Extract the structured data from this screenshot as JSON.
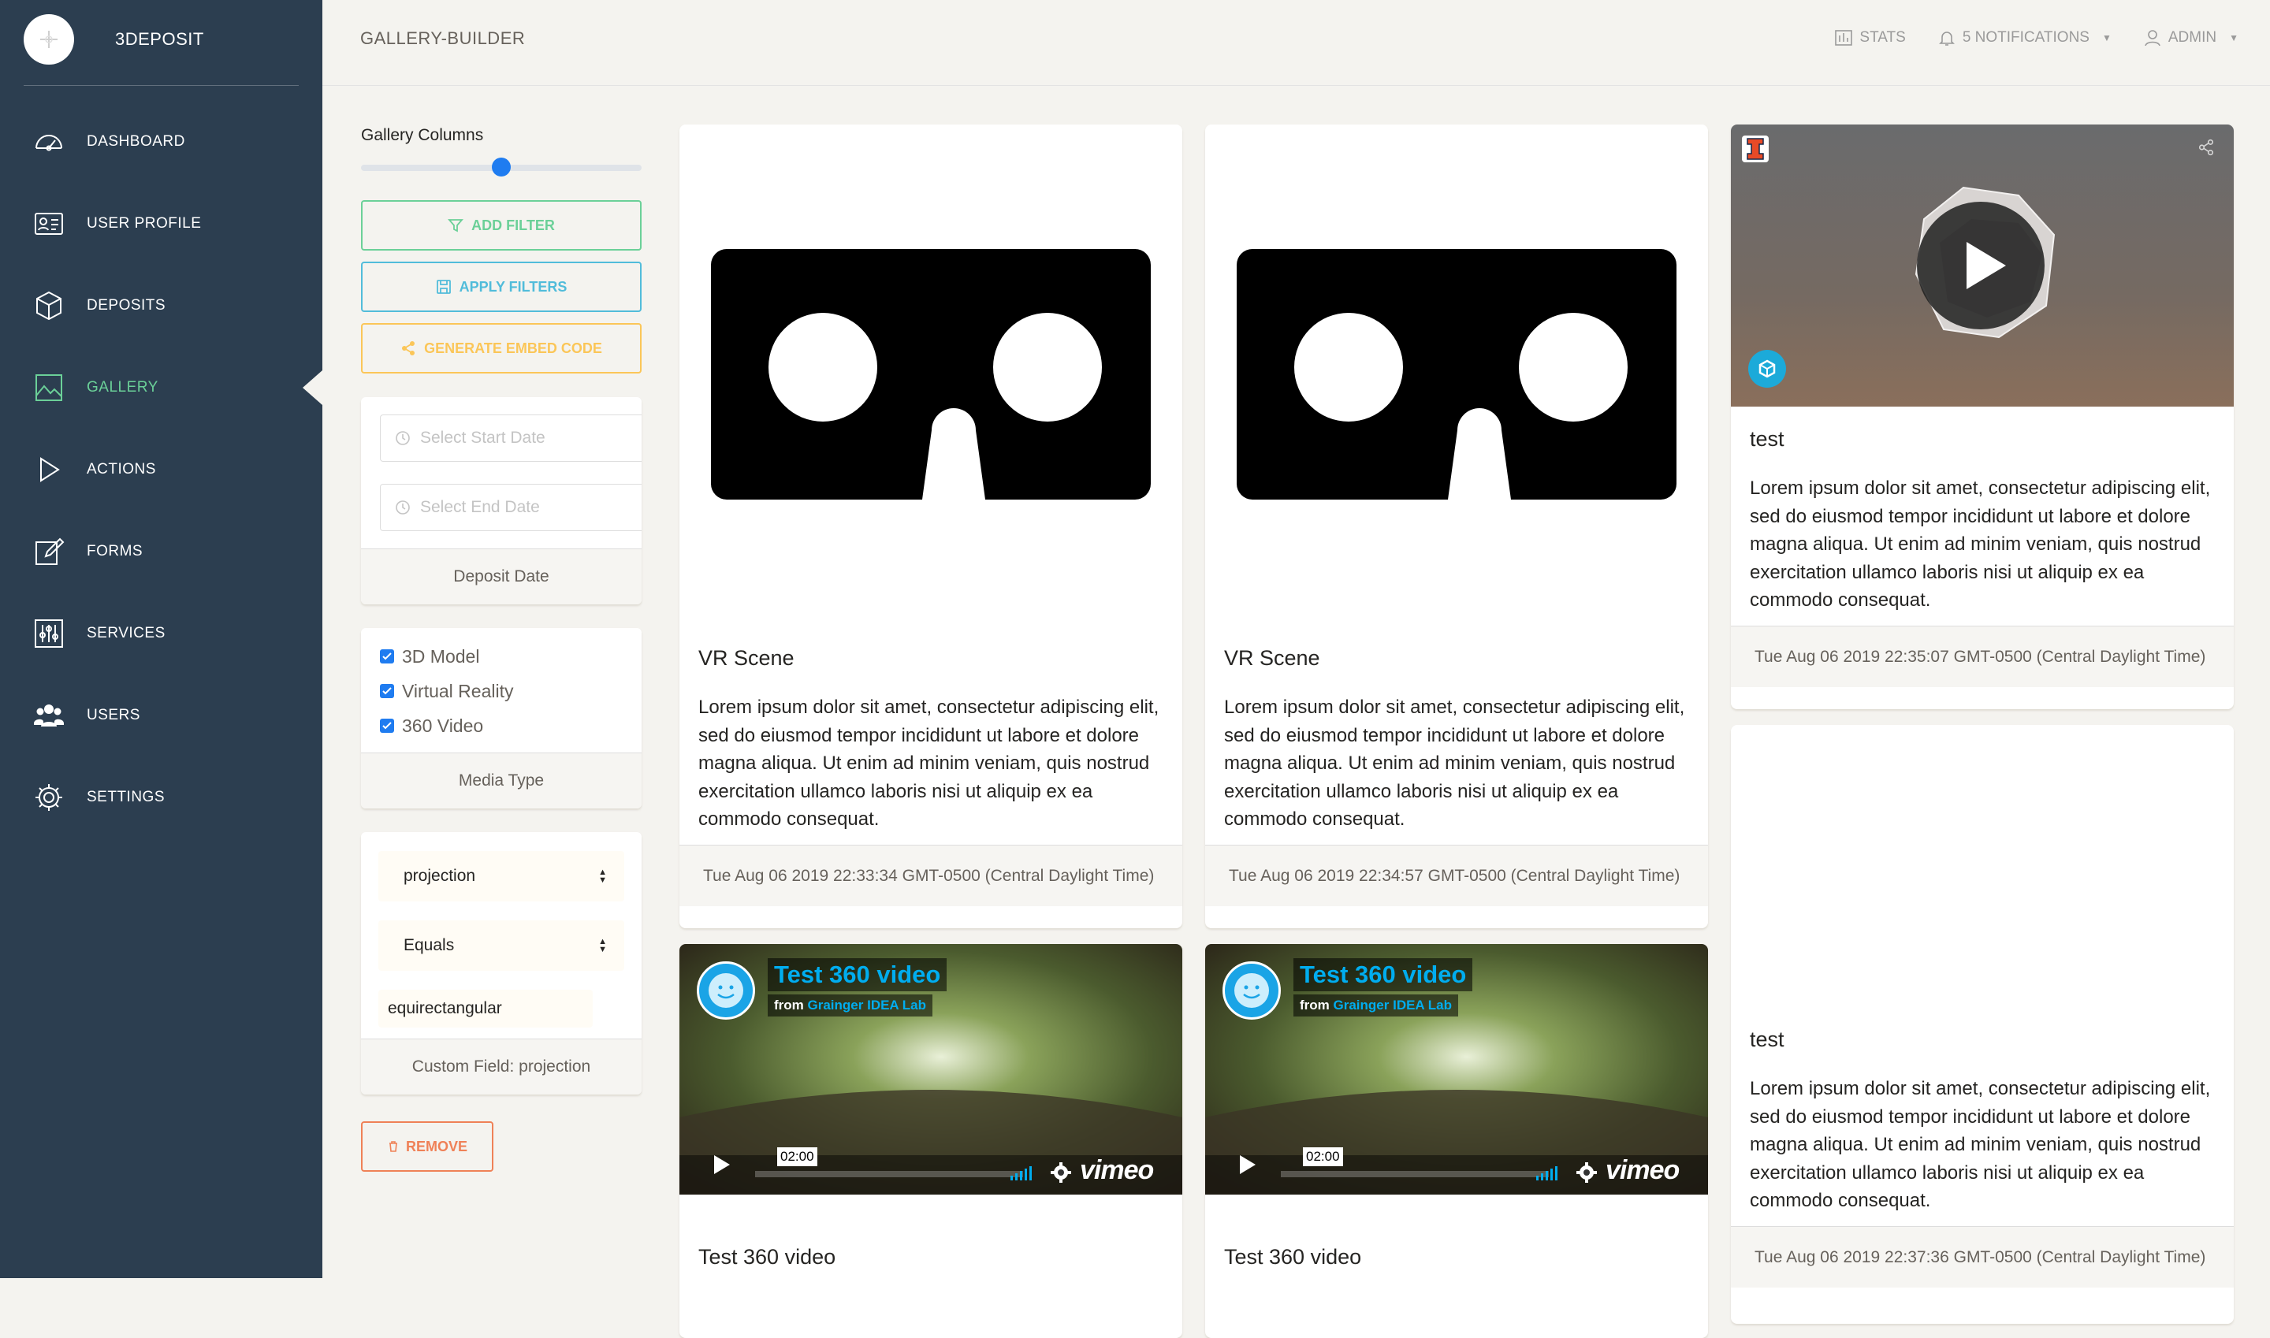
{
  "brand": {
    "name": "3DEPOSIT"
  },
  "nav": [
    {
      "label": "DASHBOARD",
      "icon": "dashboard-icon"
    },
    {
      "label": "USER PROFILE",
      "icon": "user-profile-icon"
    },
    {
      "label": "DEPOSITS",
      "icon": "box-icon"
    },
    {
      "label": "GALLERY",
      "icon": "gallery-icon",
      "active": true
    },
    {
      "label": "ACTIONS",
      "icon": "play-icon"
    },
    {
      "label": "FORMS",
      "icon": "edit-icon"
    },
    {
      "label": "SERVICES",
      "icon": "sliders-icon"
    },
    {
      "label": "USERS",
      "icon": "users-icon"
    },
    {
      "label": "SETTINGS",
      "icon": "gear-icon"
    }
  ],
  "topbar": {
    "title": "GALLERY-BUILDER",
    "stats": "STATS",
    "notifications": "5 NOTIFICATIONS",
    "user": "ADMIN"
  },
  "filters": {
    "columns_label": "Gallery Columns",
    "columns_slider_fraction": 0.5,
    "add_filter": "ADD FILTER",
    "apply_filters": "APPLY FILTERS",
    "embed_code": "GENERATE EMBED CODE",
    "start_date_placeholder": "Select Start Date",
    "end_date_placeholder": "Select End Date",
    "deposit_date_label": "Deposit Date",
    "media_types": [
      "3D Model",
      "Virtual Reality",
      "360 Video"
    ],
    "media_type_label": "Media Type",
    "custom_field_select": "projection",
    "operator_select": "Equals",
    "custom_value": "equirectangular",
    "custom_field_label": "Custom Field: projection",
    "remove": "REMOVE"
  },
  "lorem": "Lorem ipsum dolor sit amet, consectetur adipiscing elit, sed do eiusmod tempor incididunt ut labore et dolore magna aliqua. Ut enim ad minim veniam, quis nostrud exercitation ullamco laboris nisi ut aliquip ex ea commodo consequat.",
  "cards": [
    {
      "title": "VR Scene",
      "date": "Tue Aug 06 2019 22:33:34 GMT-0500 (Central Daylight Time)"
    },
    {
      "title": "VR Scene",
      "date": "Tue Aug 06 2019 22:34:57 GMT-0500 (Central Daylight Time)"
    },
    {
      "title": "test",
      "date": "Tue Aug 06 2019 22:35:07 GMT-0500 (Central Daylight Time)"
    },
    {
      "title": "test",
      "date": "Tue Aug 06 2019 22:37:36 GMT-0500 (Central Daylight Time)"
    },
    {
      "title": "Test 360 video"
    },
    {
      "title": "Test 360 video"
    }
  ],
  "video": {
    "title": "Test 360 video",
    "from_prefix": "from",
    "from_name": "Grainger IDEA Lab",
    "duration": "02:00",
    "brand": "vimeo"
  },
  "colors": {
    "sidebar": "#2c3e50",
    "accent_green": "#6bd098",
    "accent_blue": "#51bcda",
    "accent_orange": "#fbc658",
    "danger": "#ef8157",
    "primary": "#1f7cf0"
  }
}
